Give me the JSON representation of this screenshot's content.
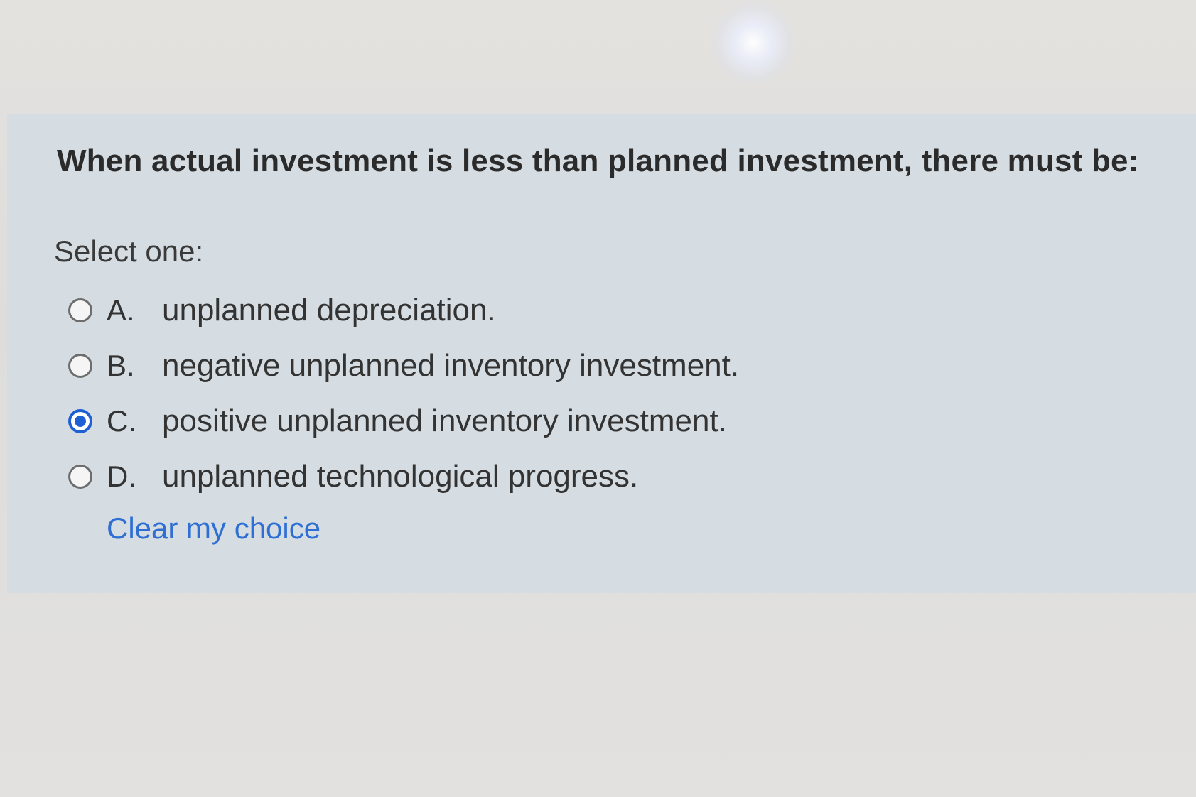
{
  "question": {
    "text": "When actual investment is less than planned investment, there must be:",
    "prompt": "Select one:"
  },
  "options": [
    {
      "letter": "A.",
      "text": "unplanned depreciation.",
      "selected": false
    },
    {
      "letter": "B.",
      "text": "negative unplanned inventory investment.",
      "selected": false
    },
    {
      "letter": "C.",
      "text": "positive unplanned inventory investment.",
      "selected": true
    },
    {
      "letter": "D.",
      "text": "unplanned technological progress.",
      "selected": false
    }
  ],
  "clear_choice_label": "Clear my choice",
  "colors": {
    "panel_background": "#d5dde2",
    "page_background": "#e2e1df",
    "selected_radio": "#1f5fd6",
    "link": "#2f6fd3"
  }
}
